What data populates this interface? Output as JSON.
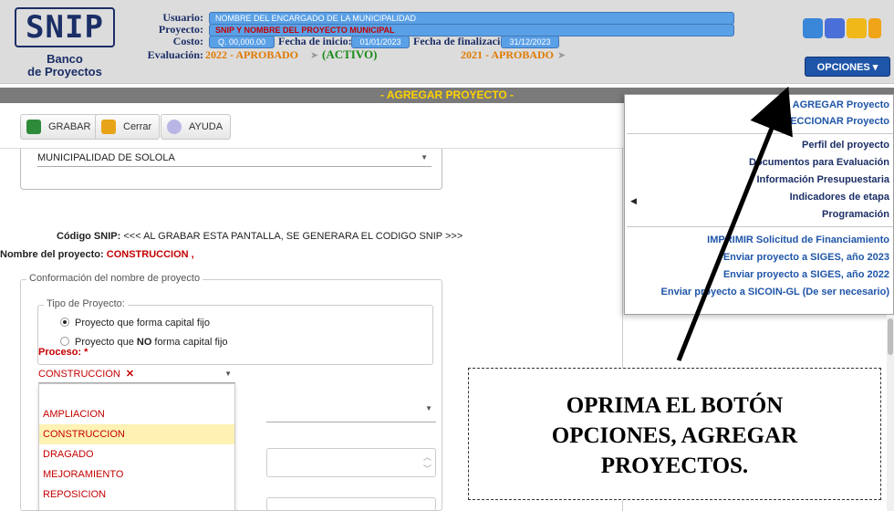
{
  "logo": {
    "main": "SNIP",
    "sub_line1": "Banco",
    "sub_line2": "de Proyectos"
  },
  "header": {
    "usuario_label": "Usuario:",
    "usuario_value": "NOMBRE DEL ENCARGADO DE LA MUNICIPALIDAD",
    "proyecto_label": "Proyecto:",
    "proyecto_value": "SNIP Y NOMBRE DEL PROYECTO MUNICIPAL",
    "costo_label": "Costo:",
    "costo_value": "Q. 00,000.00",
    "fecha_inicio_label": "Fecha de inicio:",
    "fecha_inicio_value": "01/01/2023",
    "fecha_fin_label": "Fecha de finalizacion:",
    "fecha_fin_value": "31/12/2023",
    "evaluacion_label": "Evaluación:",
    "evaluacion_1": "2022 - APROBADO",
    "activo": "(ACTIVO)",
    "evaluacion_2": "2021 - APROBADO",
    "opciones_label": "OPCIONES ▾"
  },
  "titlebar": "- AGREGAR PROYECTO -",
  "toolbar": {
    "grabar": "GRABAR",
    "cerrar": "Cerrar",
    "ayuda": "AYUDA"
  },
  "form": {
    "municipalidad": "MUNICIPALIDAD DE SOLOLA",
    "codigo_label": "Código SNIP:",
    "codigo_text": "<<< AL GRABAR ESTA PANTALLA, SE GENERARA EL CODIGO SNIP >>>",
    "nombre_label": "Nombre del proyecto:",
    "nombre_value": "CONSTRUCCION ,",
    "conformacion_legend": "Conformación del nombre de proyecto",
    "tipo_legend": "Tipo de Proyecto:",
    "tipo_opt1": "Proyecto que forma capital fijo",
    "tipo_opt2_a": "Proyecto que ",
    "tipo_opt2_b": "NO",
    "tipo_opt2_c": " forma capital fijo",
    "proceso_label": "Proceso: *",
    "proceso_value": "CONSTRUCCION",
    "proceso_options": [
      "AMPLIACION",
      "CONSTRUCCION",
      "DRAGADO",
      "MEJORAMIENTO",
      "REPOSICION"
    ]
  },
  "menu": {
    "items": [
      "AGREGAR Proyecto",
      "SELECCIONAR Proyecto",
      "Perfil del proyecto",
      "Documentos para Evaluación",
      "Información Presupuestaria",
      "Indicadores de etapa",
      "Programación",
      "IMPRIMIR Solicitud de Financiamiento",
      "Enviar proyecto a SIGES, año 2023",
      "Enviar proyecto a SIGES, año 2022",
      "Enviar proyecto a SICOIN-GL (De ser necesario)"
    ]
  },
  "annotation": {
    "line1": "OPRIMA EL BOTÓN",
    "line2": "OPCIONES, AGREGAR",
    "line3": "PROYECTOS."
  },
  "colors": {
    "accent": "#1f55a8",
    "field_bg": "#5aa0e6",
    "title_text": "#ffd200",
    "required": "#c40000"
  }
}
